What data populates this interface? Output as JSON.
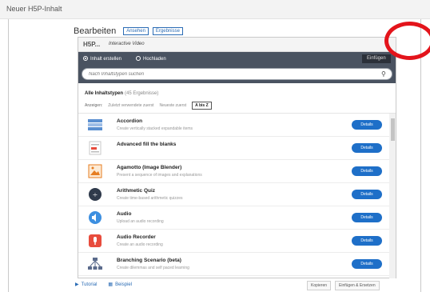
{
  "window": {
    "title": "Neuer H5P-Inhalt"
  },
  "edit": {
    "title": "Bearbeiten",
    "btn1": "Ansehen",
    "btn2": "Ergebnisse"
  },
  "hub": {
    "logo": "H5P...",
    "selected": "Interactive Video",
    "tabs": {
      "create": "Inhalt erstellen",
      "upload": "Hochladen",
      "action": "Einfügen"
    },
    "search_placeholder": "Nach Inhaltstypen suchen",
    "all_types_label": "Alle Inhaltstypen",
    "all_types_count": "(45 Ergebnisse)",
    "sort": {
      "label": "Anzeigen:",
      "options": [
        "Zuletzt verwendete zuerst",
        "Neueste zuerst",
        "A bis Z"
      ]
    },
    "details_label": "Details",
    "items": [
      {
        "name": "Accordion",
        "desc": "Create vertically stacked expandable items",
        "icon": "accordion-icon"
      },
      {
        "name": "Advanced fill the blanks",
        "desc": "",
        "icon": "fill-blanks-icon"
      },
      {
        "name": "Agamotto (Image Blender)",
        "desc": "Present a sequence of images and explanations",
        "icon": "image-blender-icon"
      },
      {
        "name": "Arithmetic Quiz",
        "desc": "Create time-based arithmetic quizzes",
        "icon": "arithmetic-icon"
      },
      {
        "name": "Audio",
        "desc": "Upload an audio recording",
        "icon": "audio-icon"
      },
      {
        "name": "Audio Recorder",
        "desc": "Create an audio recording",
        "icon": "microphone-icon"
      },
      {
        "name": "Branching Scenario (beta)",
        "desc": "Create dilemmas and self paced learning",
        "icon": "branching-icon"
      }
    ]
  },
  "footer": {
    "tutorial": "Tutorial",
    "example": "Beispiel",
    "copy": "Kopieren",
    "paste": "Einfügen & Ersetzen"
  },
  "colors": {
    "accent": "#1e6fc8",
    "hub_bar": "#4a5361",
    "highlight_circle": "#e3141b"
  }
}
